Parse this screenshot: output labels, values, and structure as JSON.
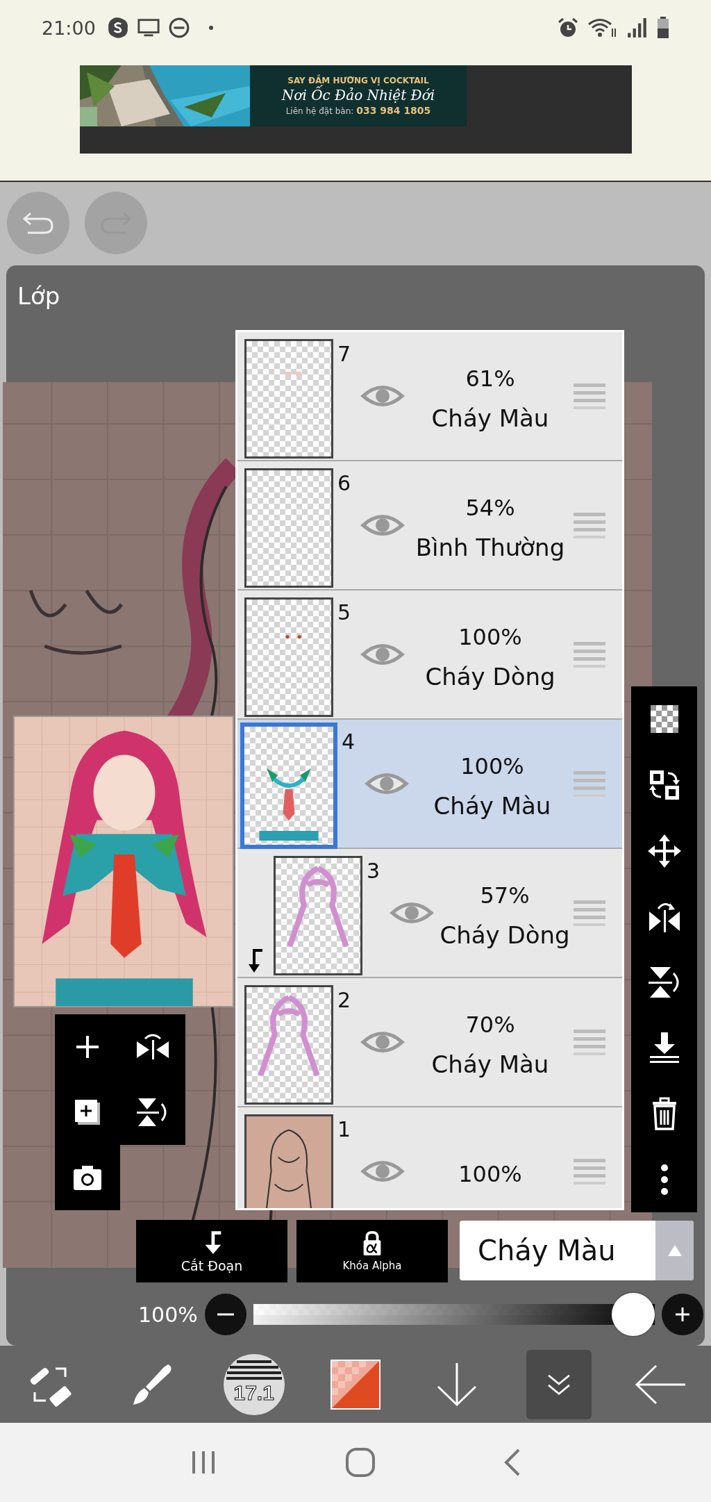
{
  "status_bar": {
    "time": "21:00"
  },
  "ad": {
    "headline": "SAY ĐẮM HƯƠNG VỊ COCKTAIL",
    "tagline": "Nơi Ốc Đảo Nhiệt Đới",
    "contact_label": "Liên hệ đặt bàn:",
    "phone": "033 984 1805"
  },
  "history": [
    {
      "kind": "undo",
      "disabled": false
    },
    {
      "kind": "redo",
      "disabled": true
    }
  ],
  "panel": {
    "title": "Lớp"
  },
  "layers": [
    {
      "number": "7",
      "opacity": "61%",
      "blend": "Cháy Màu",
      "visible": true,
      "selected": false,
      "clipped": false
    },
    {
      "number": "6",
      "opacity": "54%",
      "blend": "Bình Thường",
      "visible": true,
      "selected": false,
      "clipped": false
    },
    {
      "number": "5",
      "opacity": "100%",
      "blend": "Cháy Dòng",
      "visible": true,
      "selected": false,
      "clipped": false
    },
    {
      "number": "4",
      "opacity": "100%",
      "blend": "Cháy Màu",
      "visible": true,
      "selected": true,
      "clipped": false
    },
    {
      "number": "3",
      "opacity": "57%",
      "blend": "Cháy Dòng",
      "visible": true,
      "selected": false,
      "clipped": true
    },
    {
      "number": "2",
      "opacity": "70%",
      "blend": "Cháy Màu",
      "visible": true,
      "selected": false,
      "clipped": false
    },
    {
      "number": "1",
      "opacity": "100%",
      "visible": true,
      "selected": false,
      "clipped": false
    }
  ],
  "layer_actions": [
    {
      "kind": "clip",
      "label": "Cắt Đoạn"
    },
    {
      "kind": "alpha",
      "label": "Khóa Alpha"
    }
  ],
  "blend_mode": {
    "value": "Cháy Màu"
  },
  "opacity": {
    "reading": "100%",
    "level": 1
  },
  "brush_size": "17.1",
  "tools": [
    {
      "kind": "swap",
      "selected": false
    },
    {
      "kind": "brush",
      "selected": false
    },
    {
      "kind": "size",
      "selected": false
    },
    {
      "kind": "color",
      "selected": false
    },
    {
      "kind": "down",
      "selected": false
    },
    {
      "kind": "collapse",
      "selected": true
    },
    {
      "kind": "back",
      "selected": false
    }
  ]
}
